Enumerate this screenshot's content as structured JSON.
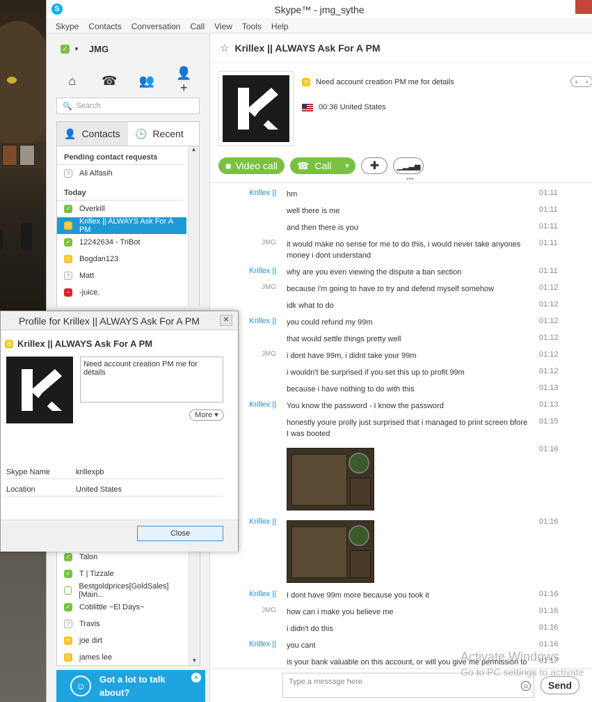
{
  "window": {
    "title": "Skype™ - jmg_sythe"
  },
  "menu": [
    "Skype",
    "Contacts",
    "Conversation",
    "Call",
    "View",
    "Tools",
    "Help"
  ],
  "me": {
    "name": "JMG"
  },
  "search": {
    "placeholder": "Search"
  },
  "tabs": {
    "contacts": "Contacts",
    "recent": "Recent"
  },
  "pending": {
    "header": "Pending contact requests",
    "items": [
      {
        "name": "Ali Alfasih",
        "status": "unknown"
      }
    ]
  },
  "today": {
    "header": "Today",
    "items": [
      {
        "name": "Överkill",
        "status": "online"
      },
      {
        "name": "Krillex || ALWAYS Ask For A PM",
        "status": "away"
      },
      {
        "name": "12242634 - TriBot",
        "status": "online"
      },
      {
        "name": "Bogdan123",
        "status": "away"
      },
      {
        "name": "Matt",
        "status": "unknown"
      },
      {
        "name": "-juice.",
        "status": "busy"
      }
    ]
  },
  "lower_contacts": [
    {
      "name": "Talon",
      "status": "online"
    },
    {
      "name": "T | Tizzale",
      "status": "online"
    },
    {
      "name": "Bestgoldprices[GoldSales][Main...",
      "status": "offline"
    },
    {
      "name": "Coblittle    ~El Days~",
      "status": "online"
    },
    {
      "name": "Travis",
      "status": "unknown"
    },
    {
      "name": "joe dirt",
      "status": "away"
    },
    {
      "name": "james lee",
      "status": "away"
    }
  ],
  "ad": {
    "text": "Got a lot to talk about?"
  },
  "conversation": {
    "name": "Krillex || ALWAYS Ask For A PM",
    "mood": "Need account creation PM me for details",
    "localtime_location": "00:36 United States",
    "video_call": "Video call",
    "call": "Call"
  },
  "messages": [
    {
      "from": "Krillex ||",
      "who": "k",
      "text": "hm",
      "time": "01:11"
    },
    {
      "from": "",
      "who": "k",
      "text": "well there is me",
      "time": "01:11"
    },
    {
      "from": "",
      "who": "k",
      "text": "and then there is you",
      "time": "01:11"
    },
    {
      "from": "JMG",
      "who": "j",
      "text": "it would make no sense for me to do this, i would never take anyones money i dont understand",
      "time": "01:11"
    },
    {
      "from": "Krillex ||",
      "who": "k",
      "text": "why are you even viewing the dispute a ban section",
      "time": "01:11"
    },
    {
      "from": "JMG",
      "who": "j",
      "text": "because i'm going to have to try and defend myself somehow",
      "time": "01:12"
    },
    {
      "from": "",
      "who": "j",
      "text": "idk what to do",
      "time": "01:12"
    },
    {
      "from": "Krillex ||",
      "who": "k",
      "text": "you could refund my 99m",
      "time": "01:12"
    },
    {
      "from": "",
      "who": "k",
      "text": "that would settle things pretty well",
      "time": "01:12"
    },
    {
      "from": "JMG",
      "who": "j",
      "text": "i dont have 99m, i didnt take your 99m",
      "time": "01:12"
    },
    {
      "from": "",
      "who": "j",
      "text": "i wouldn't be surprised if you set this up to profit 99m",
      "time": "01:12"
    },
    {
      "from": "",
      "who": "j",
      "text": "because i have nothing to do with this",
      "time": "01:13"
    },
    {
      "from": "Krillex ||",
      "who": "k",
      "text": "You know the password - I know the password",
      "time": "01:13"
    },
    {
      "from": "",
      "who": "k",
      "text": "honestly youre prolly just surprised that i managed to print screen bfore I was booted",
      "time": "01:15"
    },
    {
      "from": "",
      "who": "k",
      "text": "",
      "time": "01:16",
      "image": true
    },
    {
      "from": "Krillex ||",
      "who": "k",
      "text": "",
      "time": "01:16",
      "image": true
    },
    {
      "from": "Krillex ||",
      "who": "k",
      "text": "I dont have 99m more because you took it",
      "time": "01:16"
    },
    {
      "from": "JMG",
      "who": "j",
      "text": "how can i make you believe me",
      "time": "01:16"
    },
    {
      "from": "",
      "who": "j",
      "text": "i didn't do this",
      "time": "01:16"
    },
    {
      "from": "Krillex ||",
      "who": "k",
      "text": "you cant",
      "time": "01:16"
    },
    {
      "from": "",
      "who": "k",
      "text": "is your bank valuable on this account, or will you give me permission to",
      "time": "01:17"
    }
  ],
  "input": {
    "placeholder": "Type a message here",
    "send": "Send"
  },
  "watermark": {
    "line1": "Activate Windows",
    "line2": "Go to PC settings to activate"
  },
  "dialog": {
    "title": "Profile for Krillex || ALWAYS Ask For A PM",
    "name": "Krillex || ALWAYS Ask For A PM",
    "mood": "Need account creation PM me for details",
    "more": "More",
    "fields": [
      {
        "key": "Skype Name",
        "value": "krillexpb"
      },
      {
        "key": "Location",
        "value": "United States"
      }
    ],
    "close": "Close"
  }
}
